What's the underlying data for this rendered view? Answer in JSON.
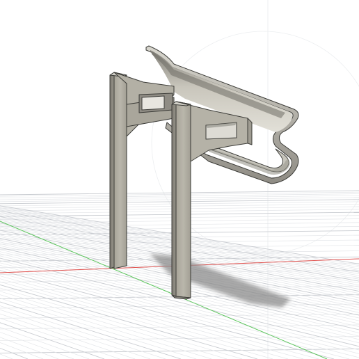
{
  "view": {
    "type": "3d-cad-viewport",
    "background_color": "#ffffff",
    "grid_color": "#d6d8dc",
    "x_axis_color": "#e0524f",
    "y_axis_color": "#5cc65c",
    "z_axis_color": "#dde0e4",
    "part_face_color": "#b7b4a9",
    "part_shadow_color": "#8f8c83",
    "ground_shadow_color": "#8b8b8b"
  },
  "model": {
    "part": "gutter-bracket-stand",
    "components": [
      "gutter-channel",
      "left-leg",
      "right-leg",
      "cross-brace",
      "brace-slot"
    ]
  }
}
